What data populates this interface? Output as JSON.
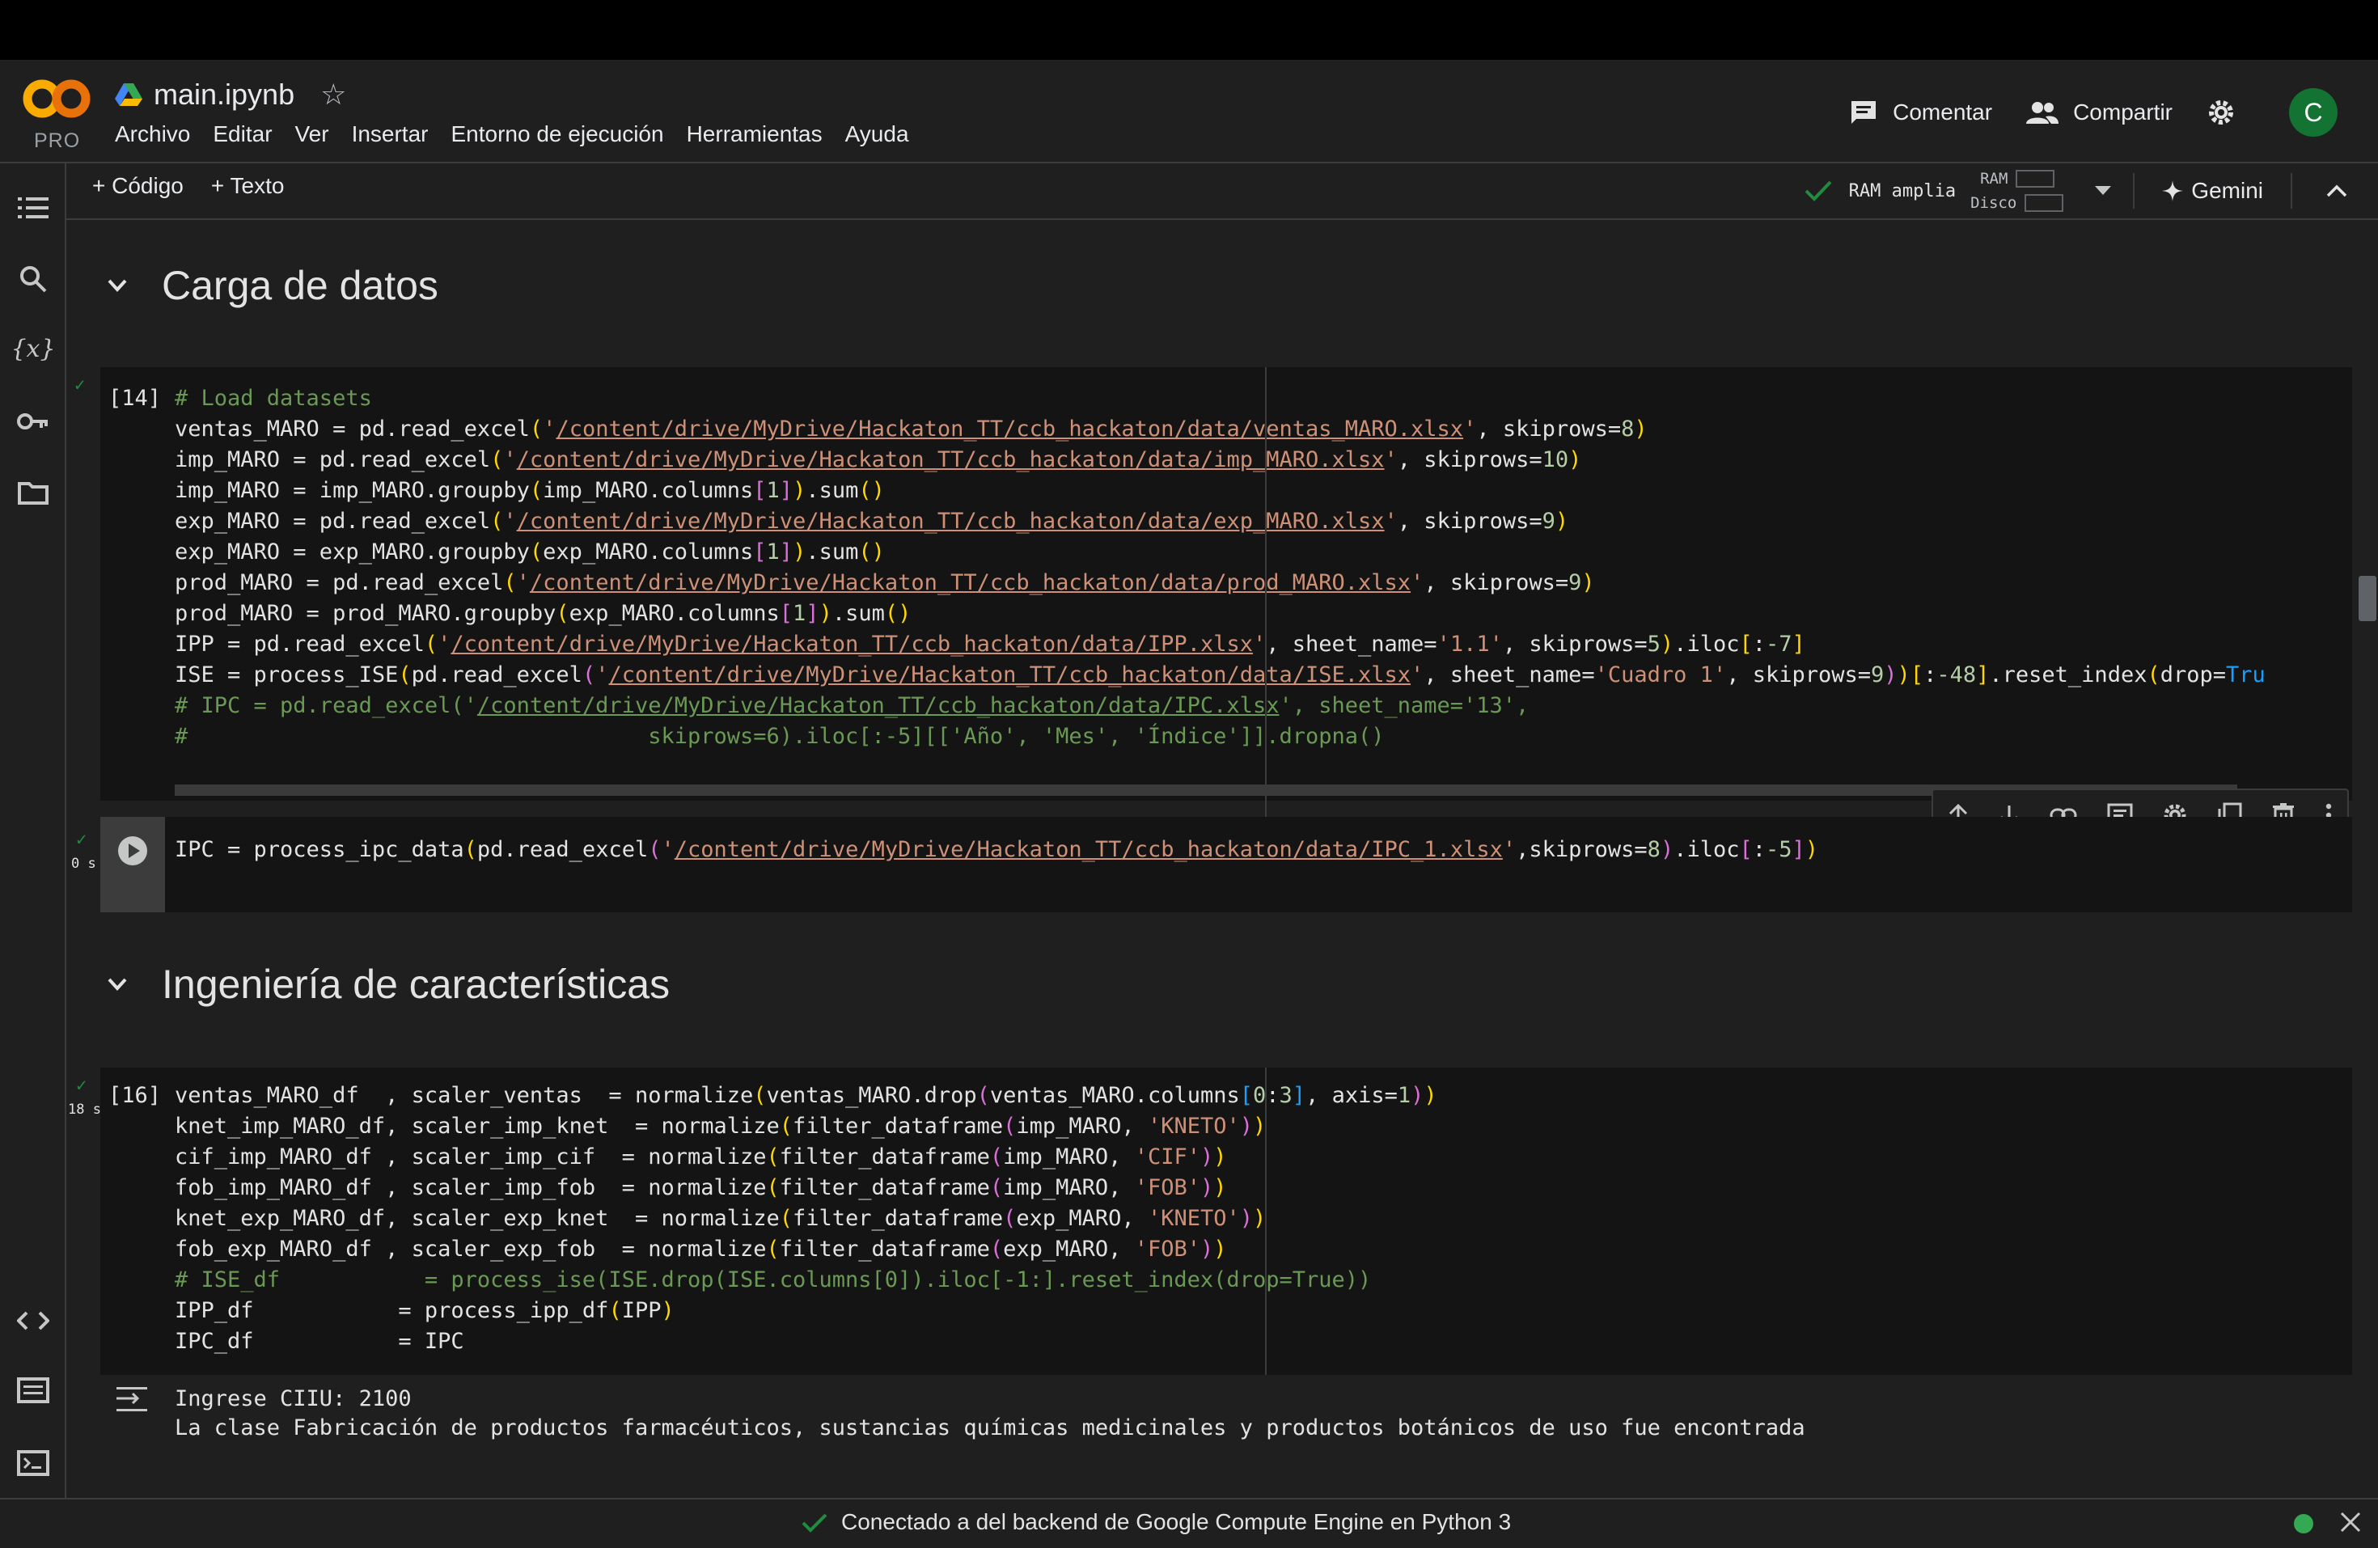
{
  "header": {
    "logo_text": "CO",
    "logo_subtitle": "PRO",
    "filename": "main.ipynb",
    "menu": [
      "Archivo",
      "Editar",
      "Ver",
      "Insertar",
      "Entorno de ejecución",
      "Herramientas",
      "Ayuda"
    ],
    "comment_label": "Comentar",
    "share_label": "Compartir",
    "avatar_letter": "C"
  },
  "toolbar": {
    "add_code_label": "+ Código",
    "add_text_label": "+ Texto",
    "runtime_label": "RAM amplia",
    "ram_label": "RAM",
    "disk_label": "Disco",
    "gemini_label": "Gemini"
  },
  "sections": [
    {
      "title": "Carga de datos"
    },
    {
      "title": "Ingeniería de características"
    }
  ],
  "cells": [
    {
      "exec_count": "[14]",
      "status": "✓"
    },
    {
      "exec_count": "",
      "status": "✓",
      "time": "0 s"
    },
    {
      "exec_count": "[16]",
      "status": "✓",
      "time": "18 s"
    }
  ],
  "output": {
    "lines": [
      "Ingrese CIIU: 2100",
      "La clase Fabricación de productos farmacéuticos, sustancias químicas medicinales y productos botánicos de uso fue encontrada"
    ]
  },
  "status_bar": {
    "message": "Conectado a del backend de Google Compute Engine en Python 3"
  },
  "colors": {
    "background": "#1f1f1f",
    "cell_background": "#141414",
    "comment": "#6a9955",
    "string": "#ce9178",
    "number": "#b5cea8",
    "success": "#1e8e3e",
    "avatar": "#137333"
  },
  "icons": [
    "colab-logo-icon",
    "drive-icon",
    "star-icon",
    "comment-icon",
    "share-people-icon",
    "gear-icon",
    "toc-icon",
    "search-icon",
    "variables-icon",
    "key-icon",
    "folder-icon",
    "code-snippets-icon",
    "command-palette-icon",
    "terminal-icon",
    "check-icon",
    "chevron-down-icon",
    "sparkle-icon",
    "chevron-up-icon",
    "play-icon",
    "arrow-up-icon",
    "arrow-down-icon",
    "link-icon",
    "comment-icon",
    "settings-icon",
    "mirror-cell-icon",
    "trash-icon",
    "more-vert-icon",
    "output-icon",
    "close-icon"
  ]
}
